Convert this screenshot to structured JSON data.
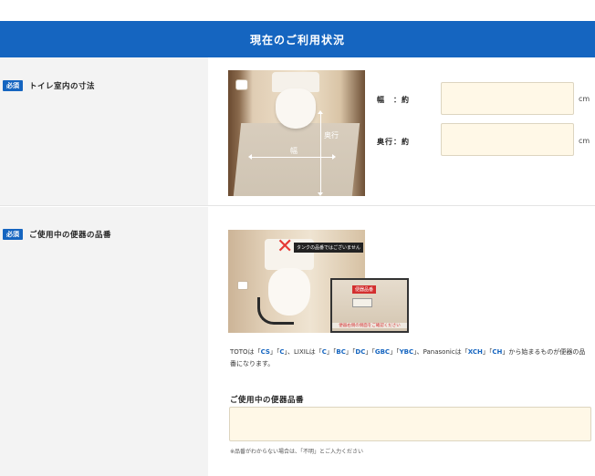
{
  "header": {
    "title": "現在のご利用状況"
  },
  "section_size": {
    "badge": "必須",
    "label": "トイレ室内の寸法",
    "photo_labels": {
      "width": "幅",
      "depth": "奥行"
    },
    "fields": [
      {
        "label": "幅　：約",
        "value": "",
        "unit": "cm"
      },
      {
        "label": "奥行：約",
        "value": "",
        "unit": "cm"
      }
    ]
  },
  "section_model": {
    "badge": "必須",
    "label": "ご使用中の便器の品番",
    "photo_banner": "タンクの品番ではございません",
    "inset_tag": "便器品番",
    "inset_caption": "便器右側の側面をご確認ください",
    "description": {
      "p1": "TOTOは「",
      "c1": "CS",
      "p2": "」「",
      "c2": "C",
      "p3": "」、LIXILは「",
      "c3": "C",
      "p4": "」「",
      "c4": "BC",
      "p5": "」「",
      "c5": "DC",
      "p6": "」「",
      "c6": "GBC",
      "p7": "」「",
      "c7": "YBC",
      "p8": "」、Panasonicは「",
      "c8": "XCH",
      "p9": "」「",
      "c9": "CH",
      "p10": "」から始まるものが便器の品番になります。"
    },
    "input_title": "ご使用中の便器品番",
    "input_value": "",
    "note": "※品番がわからない場合は、「不明」とご入力ください"
  }
}
